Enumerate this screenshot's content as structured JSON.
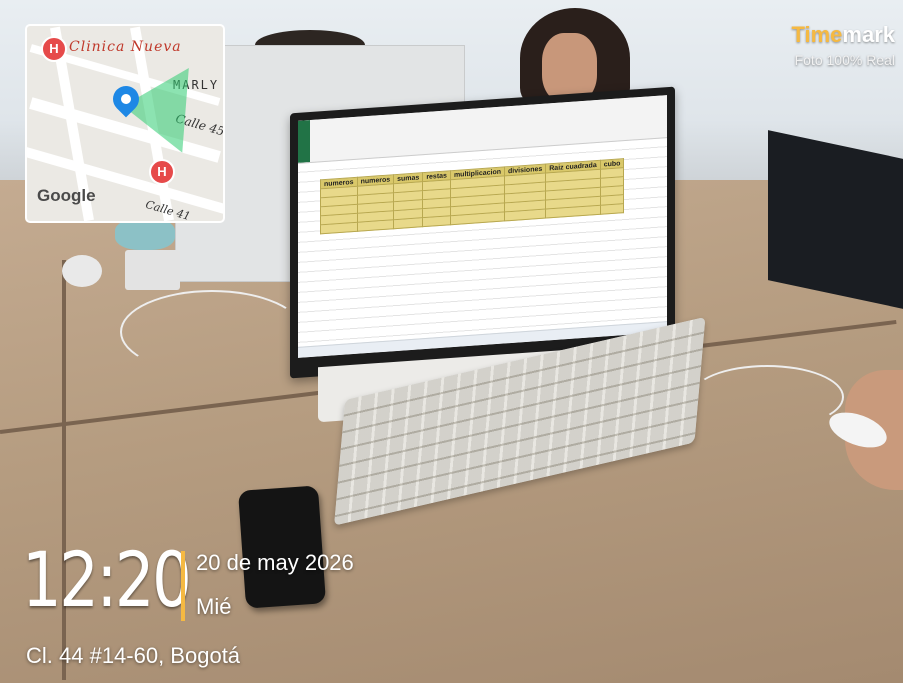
{
  "timemark": {
    "brand_time": "Time",
    "brand_mark": "mark",
    "subtitle": "Foto 100% Real"
  },
  "stamp": {
    "clock": "12:20",
    "date": "20 de may 2026",
    "weekday": "Mié",
    "address": "Cl. 44 #14-60, Bogotá"
  },
  "map": {
    "place": "Clinica Nueva",
    "area": "MARLY",
    "street_a": "Calle 45",
    "street_b": "Calle 41",
    "provider": "Google",
    "pin_letter": "H",
    "accent": "#1e88e5",
    "pin_color": "#e64a4a"
  },
  "spreadsheet": {
    "headers": [
      "numeros",
      "numeros",
      "sumas",
      "restas",
      "multiplicacion",
      "divisiones",
      "Raiz cuadrada",
      "cubo"
    ]
  }
}
